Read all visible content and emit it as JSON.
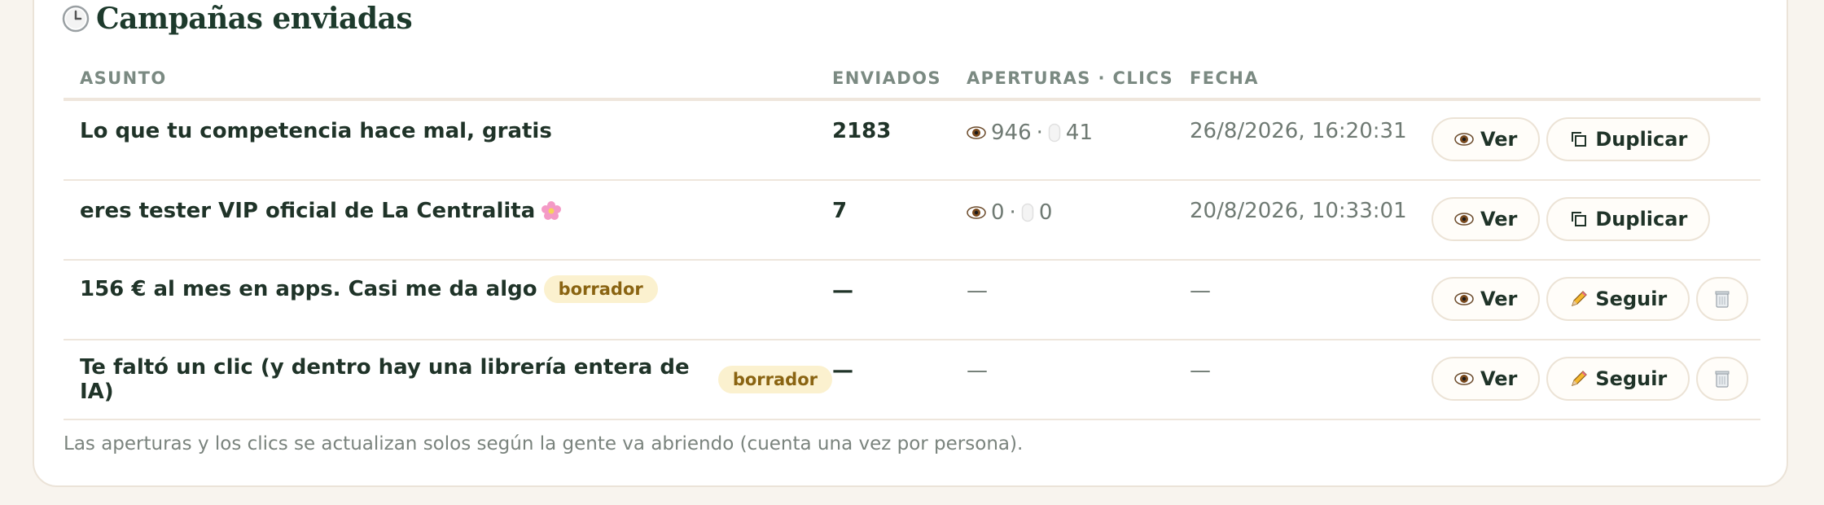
{
  "section": {
    "title": "Campañas enviadas"
  },
  "table": {
    "headers": {
      "subject": "ASUNTO",
      "sent": "ENVIADOS",
      "opens_clicks": "APERTURAS · CLICS",
      "date": "FECHA"
    },
    "rows": [
      {
        "subject": "Lo que tu competencia hace mal, gratis",
        "sent": "2183",
        "opens": "946",
        "clicks": "41",
        "date": "26/8/2026, 16:20:31",
        "view_label": "Ver",
        "secondary_label": "Duplicar"
      },
      {
        "subject": "eres tester VIP oficial de La Centralita",
        "sent": "7",
        "opens": "0",
        "clicks": "0",
        "date": "20/8/2026, 10:33:01",
        "view_label": "Ver",
        "secondary_label": "Duplicar"
      },
      {
        "subject": "156 € al mes en apps. Casi me da algo",
        "badge": "borrador",
        "sent": "—",
        "opens_clicks": "—",
        "date": "—",
        "view_label": "Ver",
        "secondary_label": "Seguir"
      },
      {
        "subject": "Te faltó un clic (y dentro hay una librería entera de IA)",
        "badge": "borrador",
        "sent": "—",
        "opens_clicks": "—",
        "date": "—",
        "view_label": "Ver",
        "secondary_label": "Seguir"
      }
    ],
    "separator": "·"
  },
  "footnote": "Las aperturas y los clics se actualizan solos según la gente va abriendo (cuenta una vez por persona).",
  "icons": {
    "title": "clock-icon",
    "view": "eye-icon",
    "duplicate": "copy-icon",
    "continue": "pencil-icon",
    "delete": "trash-icon",
    "clicks": "mouse-icon",
    "subject_emoji": "flower-icon"
  },
  "colors": {
    "title": "#1d3a2c",
    "badge_bg": "#fbf1cf",
    "badge_text": "#8a6412",
    "page_bg": "#f8f4ee"
  }
}
